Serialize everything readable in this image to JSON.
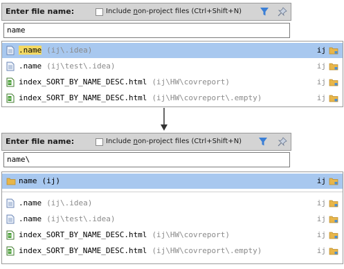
{
  "panel1": {
    "title": "Enter file name:",
    "include_label_prefix": "Include ",
    "include_label_underlined": "n",
    "include_label_suffix": "on-project files (Ctrl+Shift+N)",
    "query": "name",
    "rows": [
      {
        "name_hl": ".name",
        "name_rest": "",
        "path": "(ij\\.idea)",
        "project": "ij",
        "icon": "text-file-icon"
      },
      {
        "name_hl": "",
        "name_rest": ".name",
        "path": "(ij\\test\\.idea)",
        "project": "ij",
        "icon": "text-file-icon"
      },
      {
        "name_hl": "",
        "name_rest": "index_SORT_BY_NAME_DESC.html",
        "path": "(ij\\HW\\covreport)",
        "project": "ij",
        "icon": "html-file-icon"
      },
      {
        "name_hl": "",
        "name_rest": "index_SORT_BY_NAME_DESC.html",
        "path": "(ij\\HW\\covreport\\.empty)",
        "project": "ij",
        "icon": "html-file-icon"
      }
    ]
  },
  "panel2": {
    "title": "Enter file name:",
    "include_label_prefix": "Include ",
    "include_label_underlined": "n",
    "include_label_suffix": "on-project files (Ctrl+Shift+N)",
    "query": "name\\",
    "dir_row": {
      "name": "name",
      "path": "(ij)",
      "project": "ij"
    },
    "rows": [
      {
        "name": ".name",
        "path": "(ij\\.idea)",
        "project": "ij",
        "icon": "text-file-icon"
      },
      {
        "name": ".name",
        "path": "(ij\\test\\.idea)",
        "project": "ij",
        "icon": "text-file-icon"
      },
      {
        "name": "index_SORT_BY_NAME_DESC.html",
        "path": "(ij\\HW\\covreport)",
        "project": "ij",
        "icon": "html-file-icon"
      },
      {
        "name": "index_SORT_BY_NAME_DESC.html",
        "path": "(ij\\HW\\covreport\\.empty)",
        "project": "ij",
        "icon": "html-file-icon"
      }
    ]
  },
  "colors": {
    "selection": "#a8c8ef",
    "highlight": "#f3d964",
    "funnel": "#3b7fd6",
    "folder": "#e8b64a"
  }
}
